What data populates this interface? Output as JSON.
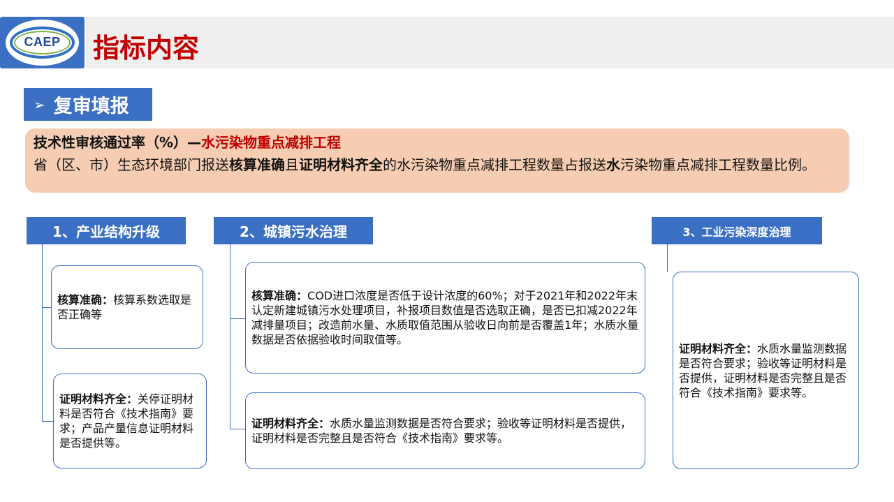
{
  "header": {
    "logo_text": "CAEP",
    "title": "指标内容"
  },
  "section": {
    "arrow": "➢",
    "label": "复审填报"
  },
  "definition": {
    "title_prefix": "技术性审核通过率（%）—",
    "title_highlight": "水污染物重点减排工程",
    "body_1": "省（区、市）生态环境部门报送",
    "body_2": "核算准确",
    "body_3": "且",
    "body_4": "证明材料齐全",
    "body_5": "的水污染物重点减排工程数量占报送",
    "body_6": "水",
    "body_7": "污染物重点减排工程数量比例。"
  },
  "categories": [
    {
      "label": "1、产业结构升级",
      "cards": [
        {
          "bold": "核算准确：",
          "text": "核算系数选取是否正确等"
        },
        {
          "bold": "证明材料齐全：",
          "text": "关停证明材料是否符合《技术指南》要求；产品产量信息证明材料是否提供等。"
        }
      ]
    },
    {
      "label": "2、城镇污水治理",
      "cards": [
        {
          "bold": "核算准确：",
          "text": "COD进口浓度是否低于设计浓度的60%；对于2021年和2022年末认定新建城镇污水处理项目，补报项目数值是否选取正确，是否已扣减2022年减排量项目；改造前水量、水质取值范围从验收日向前是否覆盖1年；水质水量数据是否依据验收时间取值等。"
        },
        {
          "bold": "证明材料齐全：",
          "text": "水质水量监测数据是否符合要求；验收等证明材料是否提供，证明材料是否完整且是否符合《技术指南》要求等。"
        }
      ]
    },
    {
      "label": "3、工业污染深度治理",
      "cards": [
        {
          "bold": "证明材料齐全：",
          "text": "水质水量监测数据是否符合要求；验收等证明材料是否提供，证明材料是否完整且是否符合《技术指南》要求等。"
        }
      ]
    }
  ],
  "colors": {
    "accent_blue": "#3b6fc4",
    "title_red": "#c00000",
    "definition_bg": "#f6cdb2",
    "header_bg": "#efefef"
  }
}
